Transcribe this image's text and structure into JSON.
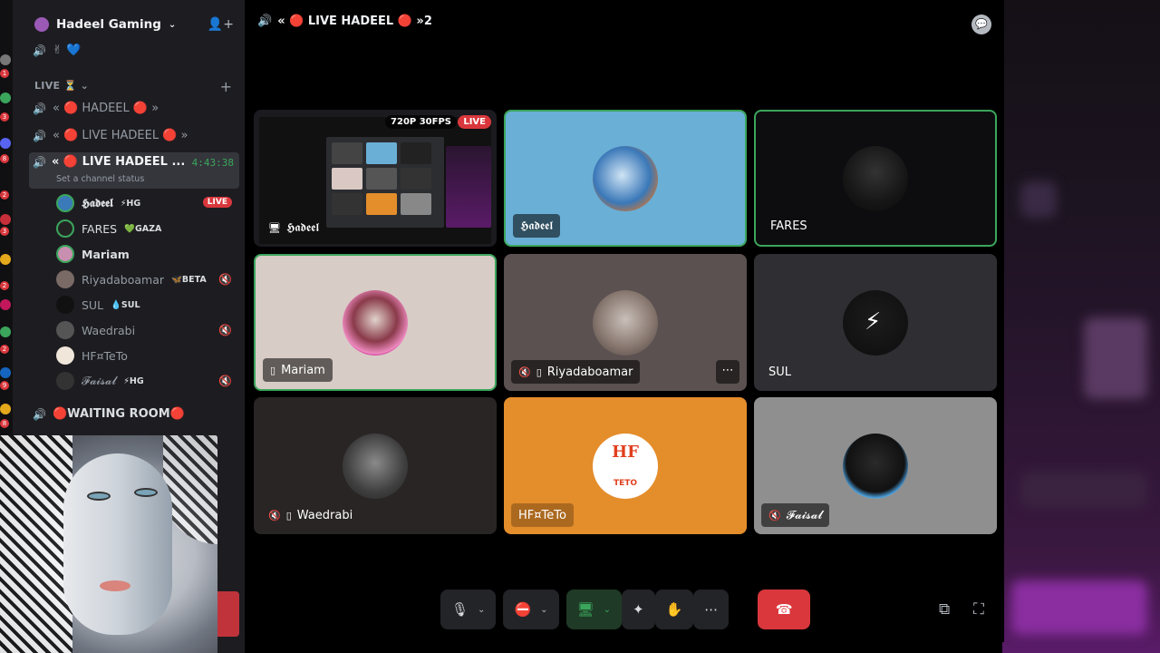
{
  "server": {
    "name": "Hadeel Gaming",
    "top_channel_emoji": "✌ 💙"
  },
  "category": {
    "name": "LIVE ⏳"
  },
  "channels": [
    {
      "label": "« 🔴 HADEEL 🔴 »"
    },
    {
      "label": "« 🔴 LIVE HADEEL 🔴 »"
    },
    {
      "label": "« 🔴 LIVE HADEEL ...",
      "timer": "4:43:38",
      "status": "Set a channel status"
    }
  ],
  "voice_users": [
    {
      "name": "𝕳𝖆𝖉𝖊𝖊𝖑",
      "tag": "⚡HG",
      "live": "LIVE"
    },
    {
      "name": "FARES",
      "tag": "💚GAZA"
    },
    {
      "name": "Mariam",
      "tag": ""
    },
    {
      "name": "Riyadaboamar",
      "tag": "🦋BETA"
    },
    {
      "name": "SUL",
      "tag": "💧SUL"
    },
    {
      "name": "Waedrabi",
      "tag": ""
    },
    {
      "name": "HF¤TeTo",
      "tag": ""
    },
    {
      "name": "𝓕𝓪𝓲𝓼𝓪𝓵",
      "tag": "⚡HG"
    }
  ],
  "waiting_room": {
    "label": "🔴WAITING ROOM🔴"
  },
  "stage": {
    "title": "« 🔴 LIVE HADEEL 🔴 »2",
    "tiles": [
      {
        "name": "𝕳𝖆𝖉𝖊𝖊𝖑",
        "quality": "720P 30FPS",
        "live": "LIVE"
      },
      {
        "name": "𝕳𝖆𝖉𝖊𝖊𝖑"
      },
      {
        "name": "FARES"
      },
      {
        "name": "Mariam"
      },
      {
        "name": "Riyadaboamar"
      },
      {
        "name": "SUL"
      },
      {
        "name": "Waedrabi"
      },
      {
        "name": "HF¤TeTo",
        "avatar_text": "HF",
        "avatar_sub": "TETO"
      },
      {
        "name": "𝓕𝓪𝓲𝓼𝓪𝓵"
      }
    ]
  },
  "colors": {
    "speaking_border": "#3ba55c",
    "live_red": "#da373c",
    "sidebar_bg": "#1d1d21",
    "tile_blue": "#6aafd6",
    "tile_orange": "#e48d2b"
  }
}
